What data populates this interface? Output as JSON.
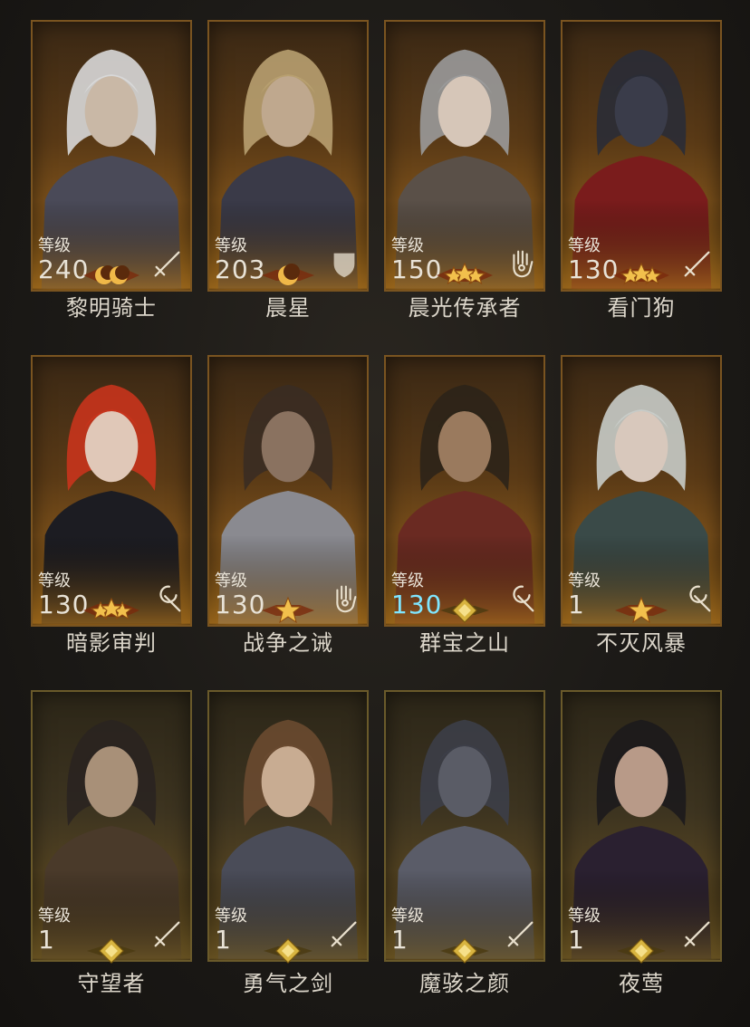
{
  "heroes": [
    {
      "name": "黎明骑士",
      "level_label": "等级",
      "level": "240",
      "class_icon": "sword-icon",
      "badge": "double-moon-badge",
      "level_color": "normal"
    },
    {
      "name": "晨星",
      "level_label": "等级",
      "level": "203",
      "class_icon": "shield-icon",
      "badge": "moon-badge",
      "level_color": "normal"
    },
    {
      "name": "晨光传承者",
      "level_label": "等级",
      "level": "150",
      "class_icon": "hand-icon",
      "badge": "triple-star-badge",
      "level_color": "normal"
    },
    {
      "name": "看门狗",
      "level_label": "等级",
      "level": "130",
      "class_icon": "sword-icon",
      "badge": "triple-star-badge",
      "level_color": "normal"
    },
    {
      "name": "暗影审判",
      "level_label": "等级",
      "level": "130",
      "class_icon": "staff-icon",
      "badge": "triple-star-badge",
      "level_color": "normal"
    },
    {
      "name": "战争之诫",
      "level_label": "等级",
      "level": "130",
      "class_icon": "hand-icon",
      "badge": "star-badge",
      "level_color": "normal"
    },
    {
      "name": "群宝之山",
      "level_label": "等级",
      "level": "130",
      "class_icon": "staff-icon",
      "badge": "diamond-badge",
      "level_color": "cyan"
    },
    {
      "name": "不灭风暴",
      "level_label": "等级",
      "level": "1",
      "class_icon": "staff-icon",
      "badge": "star-badge",
      "level_color": "normal"
    },
    {
      "name": "守望者",
      "level_label": "等级",
      "level": "1",
      "class_icon": "sword-icon",
      "badge": "diamond-badge",
      "level_color": "normal"
    },
    {
      "name": "勇气之剑",
      "level_label": "等级",
      "level": "1",
      "class_icon": "sword-icon",
      "badge": "diamond-badge",
      "level_color": "normal"
    },
    {
      "name": "魔骇之颜",
      "level_label": "等级",
      "level": "1",
      "class_icon": "sword-icon",
      "badge": "diamond-badge",
      "level_color": "normal"
    },
    {
      "name": "夜莺",
      "level_label": "等级",
      "level": "1",
      "class_icon": "sword-icon",
      "badge": "diamond-badge",
      "level_color": "normal"
    }
  ],
  "colors": {
    "card_border": "#7a5420",
    "gold": "#e0a83a",
    "level_cyan": "#7fe6ff",
    "name_text": "#dcd6ca"
  }
}
